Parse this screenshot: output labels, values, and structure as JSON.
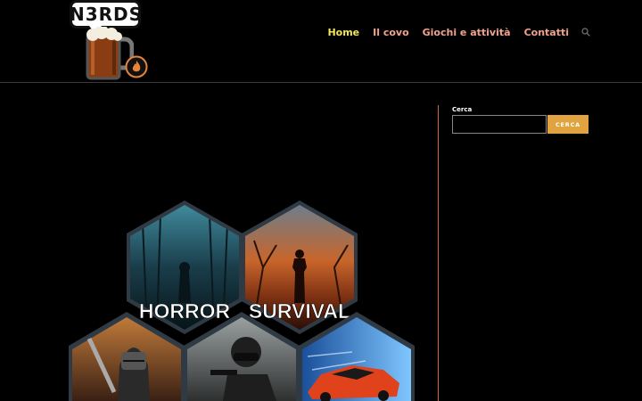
{
  "logo": {
    "text": "N3RDS"
  },
  "nav": {
    "items": [
      {
        "label": "Home",
        "active": true
      },
      {
        "label": "Il covo",
        "active": false
      },
      {
        "label": "Giochi e attività",
        "active": false
      },
      {
        "label": "Contatti",
        "active": false
      }
    ],
    "search_icon": "search-icon"
  },
  "sidebar": {
    "search": {
      "label": "Cerca",
      "placeholder": "",
      "button_label": "CERCA"
    }
  },
  "main": {
    "hexagons": [
      {
        "label": "HORROR"
      },
      {
        "label": "SURVIVAL"
      }
    ]
  },
  "colors": {
    "background": "#000000",
    "nav_active": "#f2e65a",
    "nav_link": "#f0a38a",
    "button": "#e0a340",
    "divider_accent": "#c8693f"
  }
}
